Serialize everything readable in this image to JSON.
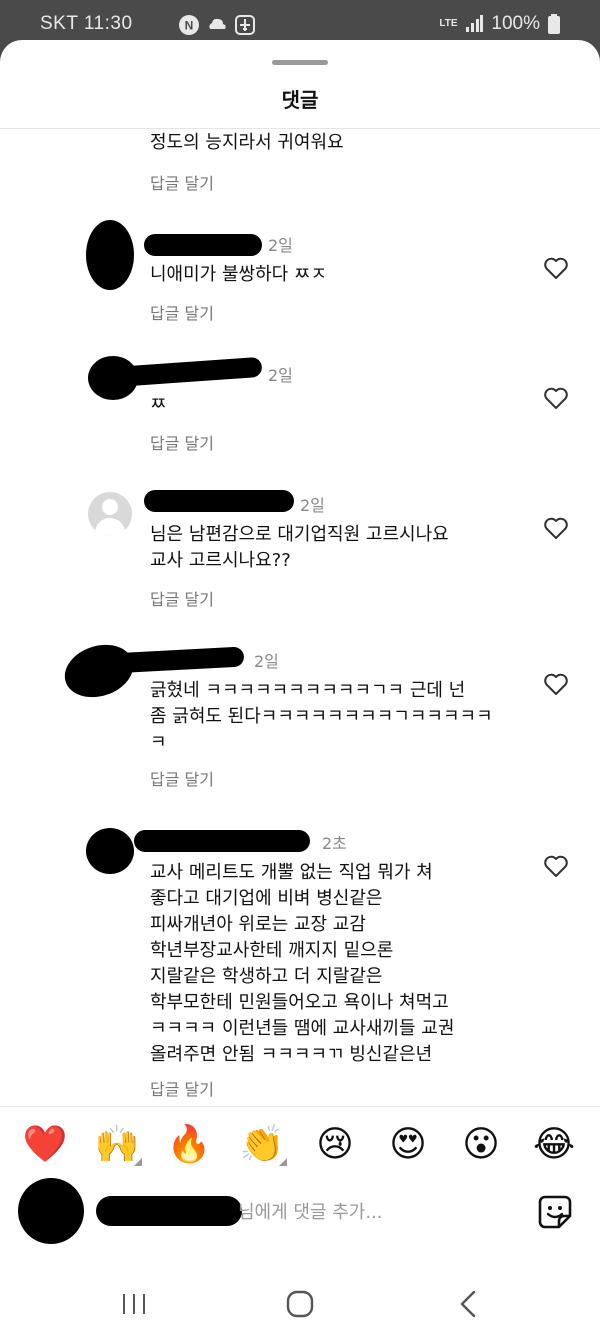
{
  "status_bar": {
    "carrier_time": "SKT 11:30",
    "network": "LTE",
    "battery": "100%"
  },
  "sheet": {
    "title": "댓글"
  },
  "comments": [
    {
      "time": "",
      "lines": [
        "정도의 능지라서 귀여워요"
      ],
      "reply": "답글 달기",
      "has_heart": false
    },
    {
      "time": "2일",
      "lines": [
        "니애미가 불쌍하다 ㅉㅈ"
      ],
      "reply": "답글 달기",
      "has_heart": true
    },
    {
      "time": "2일",
      "lines": [
        "ㅉ"
      ],
      "reply": "답글 달기",
      "has_heart": true
    },
    {
      "time": "2일",
      "lines": [
        "님은 남편감으로 대기업직원 고르시나요",
        "교사 고르시나요??"
      ],
      "reply": "답글 달기",
      "has_heart": true
    },
    {
      "time": "2일",
      "lines": [
        "긁혔네 ㅋㅋㅋㅋㅋㅋㅋㅋㅋㅋㄱㅋ 근데 넌",
        "좀 긁혀도 된다ㅋㅋㅋㅋㅋㅋㅋㅋㄱㅋㅋㅋㅋㅋ",
        "ㅋ"
      ],
      "reply": "답글 달기",
      "has_heart": true
    },
    {
      "time": "2초",
      "lines": [
        "교사 메리트도 개뿔 없는 직업 뭐가 쳐",
        "좋다고 대기업에 비벼 병신같은",
        "피싸개년아 위로는 교장 교감",
        "학년부장교사한테 깨지지 밑으론",
        "지랄같은 학생하고 더 지랄같은",
        "학부모한테 민원들어오고 욕이나 쳐먹고",
        "ㅋㅋㅋㅋ 이런년들 땜에 교사새끼들 교권",
        "올려주면 안됨 ㅋㅋㅋㅋㄲ 빙신같은년"
      ],
      "reply": "답글 달기",
      "has_heart": true
    }
  ],
  "emoji_bar": [
    {
      "name": "red-heart",
      "glyph": "❤️",
      "has_variants": false
    },
    {
      "name": "raising-hands",
      "glyph": "🙌",
      "has_variants": true
    },
    {
      "name": "fire",
      "glyph": "🔥",
      "has_variants": false
    },
    {
      "name": "clapping-hands",
      "glyph": "👏",
      "has_variants": true
    },
    {
      "name": "crying-face",
      "glyph": "😢",
      "has_variants": false
    },
    {
      "name": "heart-eyes",
      "glyph": "😍",
      "has_variants": false
    },
    {
      "name": "surprised-face",
      "glyph": "😮",
      "has_variants": false
    },
    {
      "name": "tears-of-joy",
      "glyph": "😂",
      "has_variants": false
    }
  ],
  "comment_input": {
    "placeholder": "님에게 댓글 추가..."
  },
  "icons": {
    "like": "heart-outline-icon",
    "sticker": "sticker-icon",
    "nav": [
      "recent-apps-icon",
      "home-icon",
      "back-icon"
    ]
  },
  "colors": {
    "status_bar_bg": "#4a4a4a",
    "reply_text": "#777777",
    "time_text": "#888888"
  }
}
